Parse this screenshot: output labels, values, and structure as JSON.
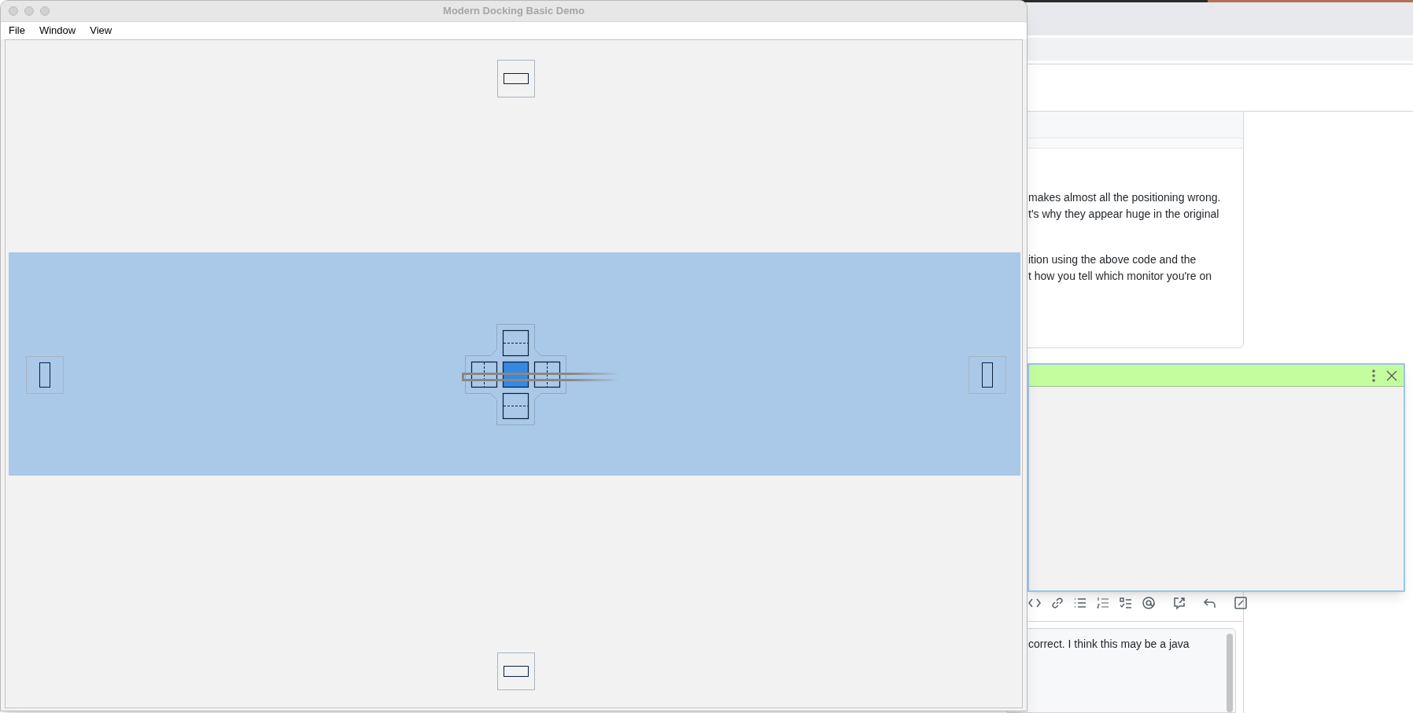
{
  "window": {
    "title": "Modern Docking Basic Demo"
  },
  "menu": [
    {
      "label": "File"
    },
    {
      "label": "Window"
    },
    {
      "label": "View"
    }
  ],
  "edge_targets": [
    {
      "kind": "top"
    },
    {
      "kind": "left"
    },
    {
      "kind": "right"
    },
    {
      "kind": "bottom"
    }
  ],
  "center_targets": [
    {
      "kind": "top",
      "selected": false
    },
    {
      "kind": "left",
      "selected": false
    },
    {
      "kind": "center",
      "selected": true
    },
    {
      "kind": "right",
      "selected": false
    },
    {
      "kind": "bottom",
      "selected": false
    }
  ],
  "background_page": {
    "comment_paragraphs": [
      [
        "makes almost all the positioning wrong.",
        "t's why they appear huge in the original"
      ],
      [
        "ition using the above code and the",
        "t how you tell which monitor you're on"
      ]
    ],
    "editor_text": "correct. I think this may be a java"
  }
}
